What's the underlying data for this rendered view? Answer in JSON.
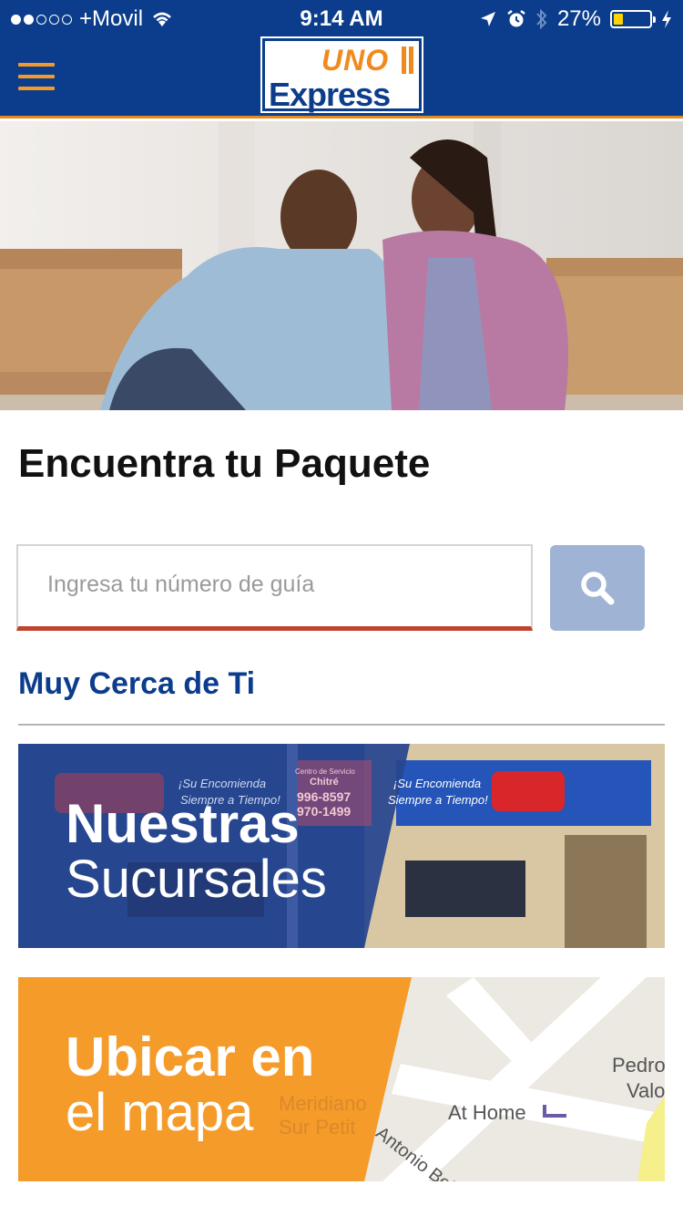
{
  "status_bar": {
    "carrier": "+Movil",
    "time": "9:14 AM",
    "battery": "27%",
    "battery_level": 0.27
  },
  "header": {
    "logo_top": "UNO",
    "logo_bottom": "Express",
    "menu_icon": "hamburger-menu-icon"
  },
  "hero": {
    "image": "couple-with-moving-boxes-photo"
  },
  "track": {
    "title": "Encuentra tu Paquete",
    "input_placeholder": "Ingresa tu número de guía",
    "input_value": "",
    "search_icon": "search-icon"
  },
  "nearby": {
    "title": "Muy Cerca de Ti"
  },
  "banners": {
    "branches": {
      "line1": "Nuestras",
      "line2": "Sucursales",
      "sign_slogan_1": "¡Su Encomienda",
      "sign_slogan_1b": "Siempre a Tiempo!",
      "sign_slogan_2": "¡Su Encomienda",
      "sign_slogan_2b": "Siempre a Tiempo!",
      "sign_center_title": "Centro de Servicio",
      "sign_center_city": "Chitré",
      "sign_phone_1": "996-8597",
      "sign_phone_2": "970-1499"
    },
    "map": {
      "line1": "Ubicar en",
      "line2": "el mapa",
      "map_labels": {
        "street_1": "Antonio Bell",
        "poi": "At Home",
        "place_1": "Pedro",
        "place_2": "Valo",
        "street_2": "Meridiano",
        "street_3": "Sur Petit"
      }
    }
  },
  "colors": {
    "brand_blue": "#0c3d8c",
    "brand_orange": "#f39a2b",
    "search_button": "#9fb4d4",
    "input_underline": "#c0432f"
  }
}
